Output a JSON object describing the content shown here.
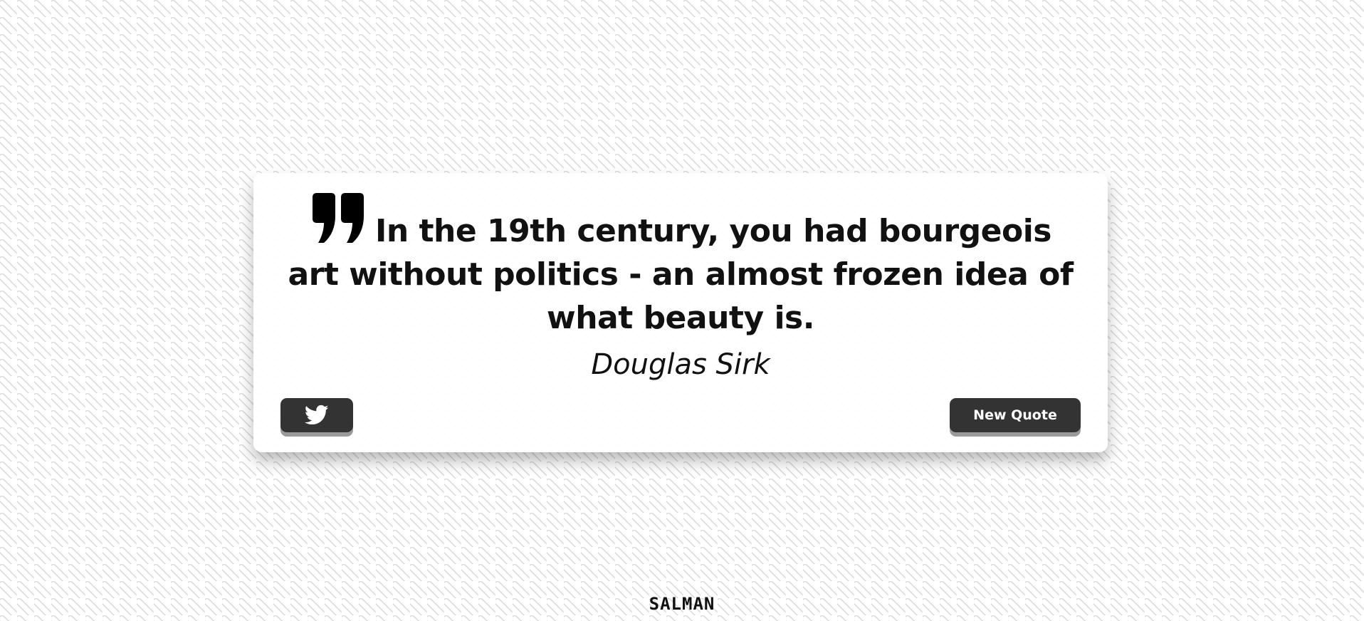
{
  "quote": {
    "text": "In the 19th century, you had bourgeois art without politics - an almost frozen idea of what beauty is.",
    "author": "Douglas Sirk",
    "icon": "quote-left-icon"
  },
  "actions": {
    "tweet_icon": "twitter-icon",
    "new_quote_label": "New Quote"
  },
  "footer": {
    "signature": "SALMAN"
  },
  "colors": {
    "button_bg": "#333333",
    "text": "#111111",
    "card_bg": "#ffffff"
  }
}
